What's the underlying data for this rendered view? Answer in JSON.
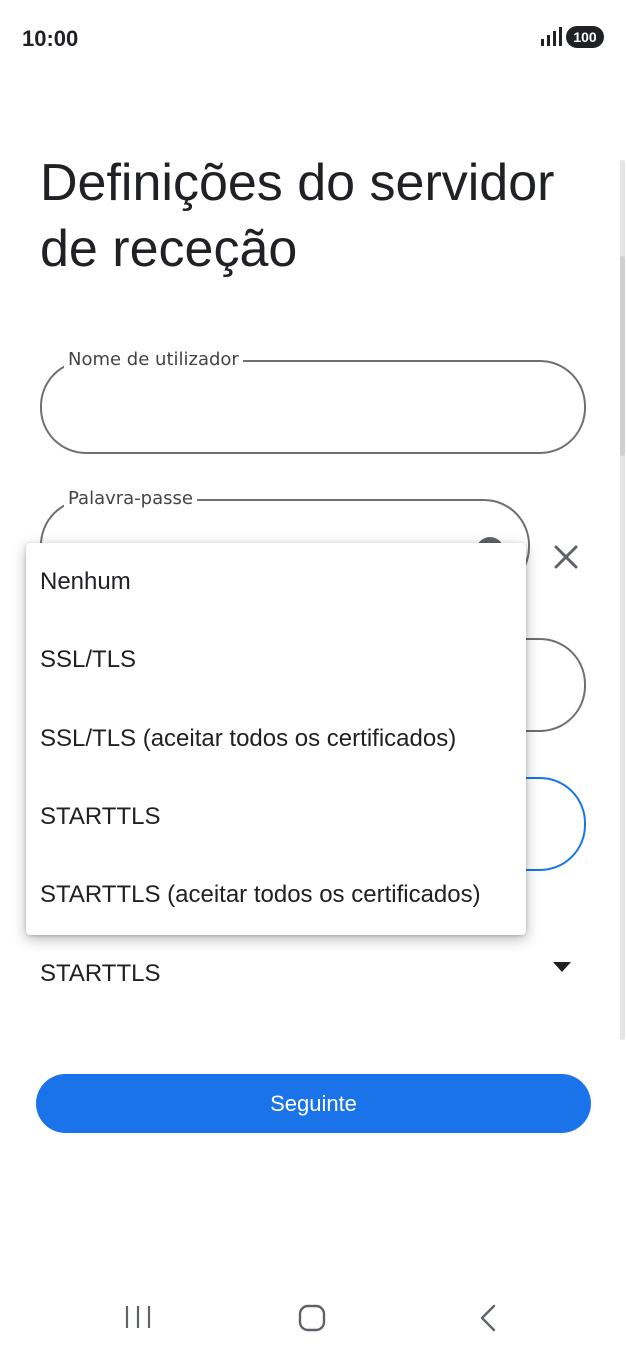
{
  "status_bar": {
    "time": "10:00",
    "battery": "100"
  },
  "title": "Definições do servidor de receção",
  "fields": {
    "username": {
      "label": "Nome de utilizador",
      "value": ""
    },
    "password": {
      "label": "Palavra-passe",
      "value": ""
    },
    "port": {
      "value": ""
    },
    "server": {
      "value": ""
    }
  },
  "security": {
    "selected": "STARTTLS"
  },
  "dropdown": {
    "options": [
      "Nenhum",
      "SSL/TLS",
      "SSL/TLS (aceitar todos os certificados)",
      "STARTTLS",
      "STARTTLS (aceitar todos os certificados)"
    ]
  },
  "buttons": {
    "next": "Seguinte"
  },
  "colors": {
    "accent": "#1a73e8",
    "outline": "#6f6f6f",
    "text": "#202124"
  },
  "icons": [
    "signal-icon",
    "visibility-icon",
    "clear-icon",
    "dropdown-arrow-icon",
    "nav-recents-icon",
    "nav-home-icon",
    "nav-back-icon"
  ]
}
